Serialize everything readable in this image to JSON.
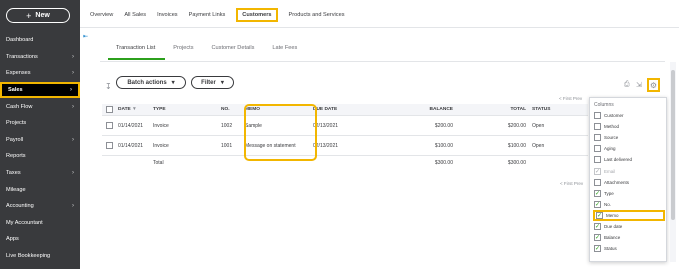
{
  "sidebar": {
    "new_label": "New",
    "items": [
      {
        "label": "Dashboard",
        "chevron": false
      },
      {
        "label": "Transactions",
        "chevron": true
      },
      {
        "label": "Expenses",
        "chevron": true
      },
      {
        "label": "Sales",
        "chevron": true
      },
      {
        "label": "Cash Flow",
        "chevron": true
      },
      {
        "label": "Projects",
        "chevron": false
      },
      {
        "label": "Payroll",
        "chevron": true
      },
      {
        "label": "Reports",
        "chevron": false
      },
      {
        "label": "Taxes",
        "chevron": true
      },
      {
        "label": "Mileage",
        "chevron": false
      },
      {
        "label": "Accounting",
        "chevron": true
      },
      {
        "label": "My Accountant",
        "chevron": false
      },
      {
        "label": "Apps",
        "chevron": false
      },
      {
        "label": "Live Bookkeeping",
        "chevron": false
      }
    ]
  },
  "top_tabs": [
    "Overview",
    "All Sales",
    "Invoices",
    "Payment Links",
    "Customers",
    "Products and Services"
  ],
  "sub_tabs": [
    "Transaction List",
    "Projects",
    "Customer Details",
    "Late Fees"
  ],
  "toolbar": {
    "batch_label": "Batch actions",
    "filter_label": "Filter",
    "pager_top": "< First  Prev"
  },
  "table": {
    "headers": {
      "date": "DATE",
      "date_sort": "▼",
      "type": "TYPE",
      "no": "NO.",
      "memo": "MEMO",
      "due": "DUE DATE",
      "balance": "BALANCE",
      "total": "TOTAL",
      "status": "STATUS"
    },
    "rows": [
      {
        "date": "01/14/2021",
        "type": "Invoice",
        "no": "1002",
        "memo": "Sample",
        "due": "02/13/2021",
        "balance": "$200.00",
        "total": "$200.00",
        "status": "Open"
      },
      {
        "date": "01/14/2021",
        "type": "Invoice",
        "no": "1001",
        "memo": "Message on statement",
        "due": "02/13/2021",
        "balance": "$100.00",
        "total": "$100.00",
        "status": "Open"
      }
    ],
    "total_label": "Total",
    "total_balance": "$300.00",
    "total_total": "$300.00",
    "pager_bottom": "< First  Prev"
  },
  "columns_dropdown": {
    "title": "Columns",
    "items": [
      {
        "label": "Customer",
        "checked": false,
        "disabled": false
      },
      {
        "label": "Method",
        "checked": false,
        "disabled": false
      },
      {
        "label": "Source",
        "checked": false,
        "disabled": false
      },
      {
        "label": "Aging",
        "checked": false,
        "disabled": false
      },
      {
        "label": "Last delivered",
        "checked": false,
        "disabled": false
      },
      {
        "label": "Email",
        "checked": true,
        "disabled": true
      },
      {
        "label": "Attachments",
        "checked": false,
        "disabled": false
      },
      {
        "label": "Type",
        "checked": true,
        "disabled": false
      },
      {
        "label": "No.",
        "checked": true,
        "disabled": false
      },
      {
        "label": "Memo",
        "checked": true,
        "disabled": false
      },
      {
        "label": "Due date",
        "checked": true,
        "disabled": false
      },
      {
        "label": "Balance",
        "checked": true,
        "disabled": false
      },
      {
        "label": "Status",
        "checked": true,
        "disabled": false
      }
    ]
  },
  "colors": {
    "sidebar_bg": "#393a3d",
    "highlight": "#f2b600",
    "accent_green": "#2ca01c"
  }
}
